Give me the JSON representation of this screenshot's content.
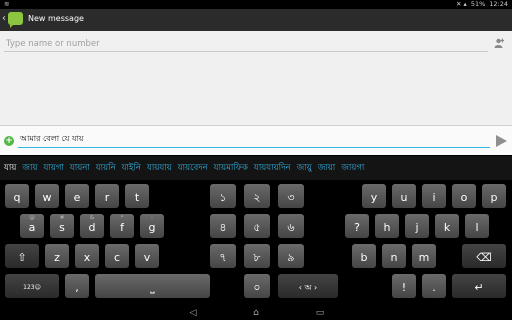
{
  "status": {
    "notif": "≋",
    "battery": "51%",
    "time": "12:24"
  },
  "actionbar": {
    "back_glyph": "‹",
    "title": "New message"
  },
  "recipient": {
    "placeholder": "Type name or number"
  },
  "compose": {
    "text": "আমার বেলা যে যায়"
  },
  "suggestions": [
    "যায়",
    "জায়",
    "যায়গা",
    "যায়না",
    "যায়নি",
    "যাইনি",
    "যায়যায়",
    "যায়বেদন",
    "যায়মাফিক",
    "যায়যায়দিন",
    "জায়ু",
    "জায়া",
    "জায়গা"
  ],
  "keyboard": {
    "left": [
      {
        "label": "q",
        "hint": ""
      },
      {
        "label": "w",
        "hint": ""
      },
      {
        "label": "e",
        "hint": ""
      },
      {
        "label": "r",
        "hint": ""
      },
      {
        "label": "t",
        "hint": ""
      },
      {
        "label": "a",
        "hint": "@"
      },
      {
        "label": "s",
        "hint": "#"
      },
      {
        "label": "d",
        "hint": "&"
      },
      {
        "label": "f",
        "hint": "*"
      },
      {
        "label": "g",
        "hint": "-"
      },
      {
        "label": "⇧",
        "hint": ""
      },
      {
        "label": "z",
        "hint": ""
      },
      {
        "label": "x",
        "hint": ""
      },
      {
        "label": "c",
        "hint": ""
      },
      {
        "label": "v",
        "hint": ""
      },
      {
        "label": "123☺",
        "hint": ""
      },
      {
        "label": ",",
        "hint": ""
      },
      {
        "label": "⎵",
        "hint": ""
      }
    ],
    "num": [
      {
        "label": "১",
        "hint": ""
      },
      {
        "label": "২",
        "hint": ""
      },
      {
        "label": "৩",
        "hint": ""
      },
      {
        "label": "৪",
        "hint": ""
      },
      {
        "label": "৫",
        "hint": ""
      },
      {
        "label": "৬",
        "hint": ""
      },
      {
        "label": "৭",
        "hint": ""
      },
      {
        "label": "৮",
        "hint": ""
      },
      {
        "label": "৯",
        "hint": ""
      },
      {
        "label": "⎵",
        "hint": ""
      },
      {
        "label": "০",
        "hint": ""
      },
      {
        "label": "‹ অ ›",
        "hint": ""
      }
    ],
    "right": [
      {
        "label": "y",
        "hint": ""
      },
      {
        "label": "u",
        "hint": ""
      },
      {
        "label": "i",
        "hint": ""
      },
      {
        "label": "o",
        "hint": ""
      },
      {
        "label": "p",
        "hint": ""
      },
      {
        "label": "?",
        "hint": ""
      },
      {
        "label": "h",
        "hint": ""
      },
      {
        "label": "j",
        "hint": ""
      },
      {
        "label": "k",
        "hint": ""
      },
      {
        "label": "l",
        "hint": ""
      },
      {
        "label": "b",
        "hint": ""
      },
      {
        "label": "n",
        "hint": ""
      },
      {
        "label": "m",
        "hint": ""
      },
      {
        "label": "⌫",
        "hint": ""
      },
      {
        "label": "!",
        "hint": ""
      },
      {
        "label": ".",
        "hint": ""
      },
      {
        "label": "↵",
        "hint": ""
      }
    ]
  },
  "nav": {
    "back": "◁",
    "home": "⌂",
    "recents": "▭"
  }
}
